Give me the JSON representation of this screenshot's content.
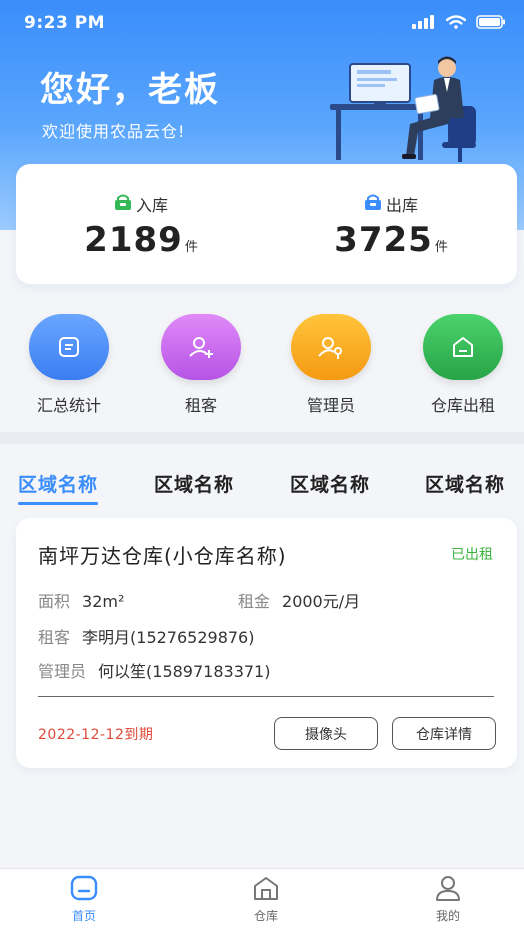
{
  "status_bar": {
    "time": "9:23 PM"
  },
  "header": {
    "greeting": "您好，老板",
    "welcome": "欢迎使用农品云仓!"
  },
  "stats": {
    "in": {
      "label": "入库",
      "value": "2189",
      "unit": "件"
    },
    "out": {
      "label": "出库",
      "value": "3725",
      "unit": "件"
    }
  },
  "menu": [
    {
      "label": "汇总统计",
      "icon": "summary-icon",
      "color": "#4f8ff5"
    },
    {
      "label": "租客",
      "icon": "add-user-icon",
      "color": "#c966ec"
    },
    {
      "label": "管理员",
      "icon": "admin-icon",
      "color": "#f7a71f"
    },
    {
      "label": "仓库出租",
      "icon": "warehouse-icon",
      "color": "#35b957"
    }
  ],
  "tabs": [
    "区域名称",
    "区域名称",
    "区域名称",
    "区域名称"
  ],
  "card": {
    "title": "南坪万达仓库(小仓库名称)",
    "status": "已出租",
    "area_label": "面积",
    "area_value": "32m²",
    "rent_label": "租金",
    "rent_value": "2000元/月",
    "tenant_label": "租客",
    "tenant_value": "李明月(15276529876)",
    "manager_label": "管理员",
    "manager_value": "何以笙(15897183371)",
    "expire": "2022-12-12到期",
    "camera_button": "摄像头",
    "detail_button": "仓库详情"
  },
  "tabbar": [
    {
      "label": "首页",
      "icon": "home-icon"
    },
    {
      "label": "仓库",
      "icon": "warehouse-icon"
    },
    {
      "label": "我的",
      "icon": "user-icon"
    }
  ],
  "colors": {
    "primary": "#3a8dfb",
    "rented": "#3db53d",
    "expire": "#e0493a"
  }
}
